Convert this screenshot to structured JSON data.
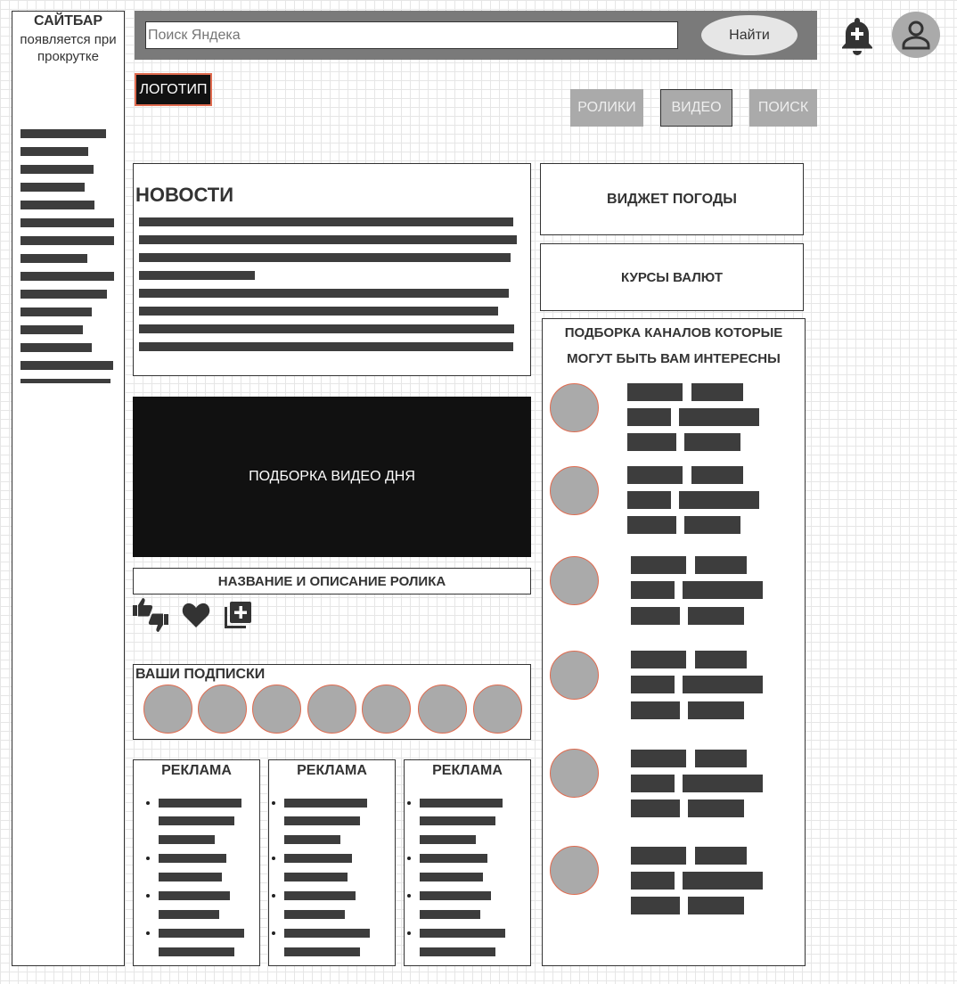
{
  "sidebar": {
    "title": "САЙТБАР",
    "subtitle": "появляется при прокрутке"
  },
  "search": {
    "placeholder": "Поиск Яндека",
    "button_label": "Найти"
  },
  "header": {
    "logo": "ЛОГОТИП",
    "notification_icon": "bell-plus-icon",
    "account_icon": "user-icon"
  },
  "nav": {
    "items": [
      {
        "label": "РОЛИКИ"
      },
      {
        "label": "ВИДЕО"
      },
      {
        "label": "ПОИСК"
      }
    ],
    "active": "ВИДЕО"
  },
  "news": {
    "title": "НОВОСТИ"
  },
  "video": {
    "banner": "ПОДБОРКА ВИДЕО ДНЯ",
    "caption": "НАЗВАНИЕ И ОПИСАНИЕ РОЛИКА",
    "actions": [
      "like-dislike-icon",
      "heart-icon",
      "add-to-playlist-icon"
    ]
  },
  "subscriptions": {
    "title": "ВАШИ ПОДПИСКИ",
    "count": 7
  },
  "ads": [
    {
      "title": "РЕКЛАМА"
    },
    {
      "title": "РЕКЛАМА"
    },
    {
      "title": "РЕКЛАМА"
    }
  ],
  "widgets": {
    "weather": "ВИДЖЕТ ПОГОДЫ",
    "currency": "КУРСЫ ВАЛЮТ"
  },
  "channels": {
    "title_line1": "ПОДБОРКА КАНАЛОВ КОТОРЫЕ",
    "title_line2": "МОГУТ БЫТЬ ВАМ ИНТЕРЕСНЫ",
    "count": 6
  },
  "colors": {
    "accent_border": "#e06b4f",
    "dark_fill": "#3d3d3d",
    "placeholder_gray": "#aaaaaa",
    "video_bg": "#111111"
  }
}
